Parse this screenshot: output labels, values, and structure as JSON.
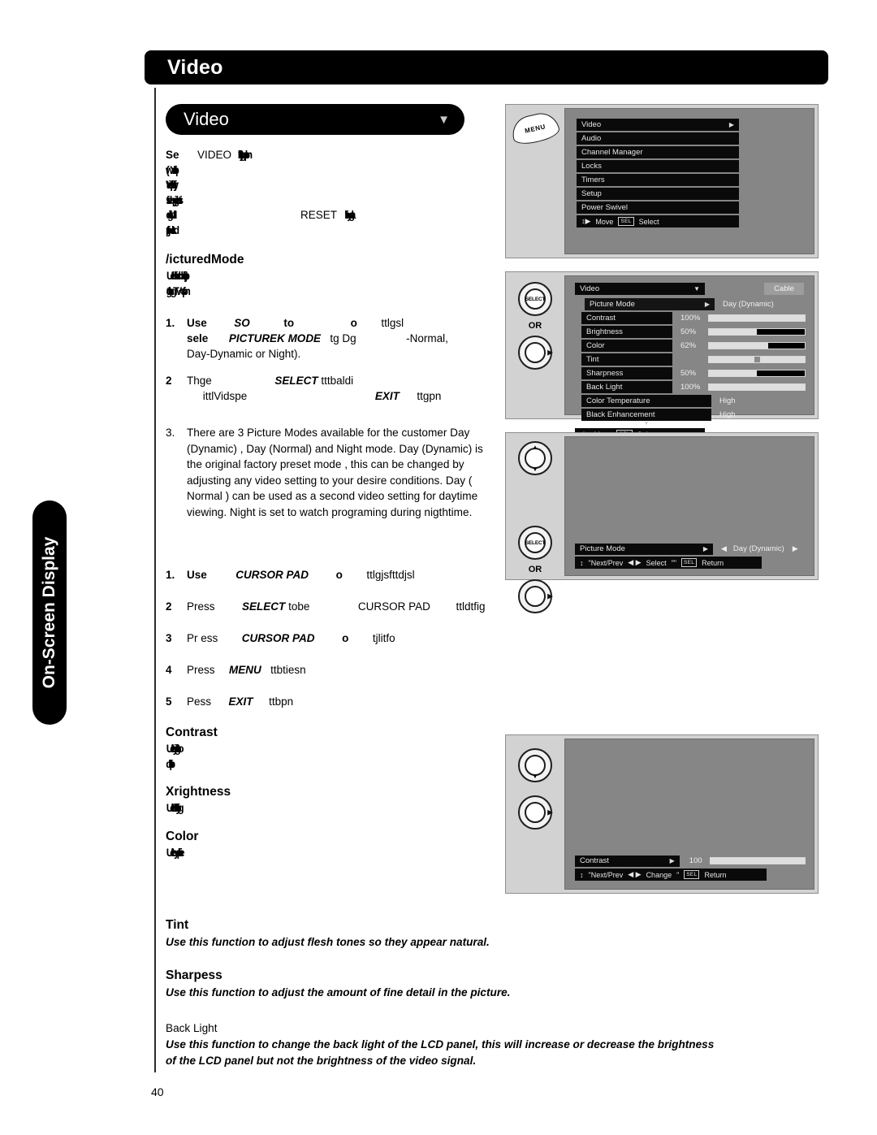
{
  "page": {
    "banner_title": "Video",
    "side_tab": "On-Screen Display",
    "page_number": "40"
  },
  "dropdown_pill": {
    "label": "Video",
    "caret": "▼"
  },
  "intro": {
    "line1_a": "Se",
    "line1_b": "VIDEO",
    "line1_c": "t)jltbgnlpn",
    "line2": "(wYqlfb",
    "line3": "tVidpsjfttiay",
    "line4": "fsebpjgbtsi",
    "line5_a": "digiMlf",
    "line5_b": "RESET",
    "line5_c": "ittbygla",
    "line6": "tpjlwcttkd"
  },
  "picture_mode": {
    "heading": "/icturedMode",
    "desc1": "Uebfbcbbfbtjp",
    "desc2": "tgtbgTV<sfpn",
    "steps": [
      {
        "idx": "1.",
        "a": "Use",
        "b": "SO",
        "c": "to",
        "d": "o",
        "e": "ttlgsl",
        "f": "sele",
        "g": "PICTUREK MODE",
        "h": "tg Dg",
        "i": "-Normal,",
        "j": "Day-Dynamic or Night)."
      },
      {
        "idx": "2",
        "a": "Thge",
        "b": "SELECT",
        "c": "tttbaldi",
        "d": "ittlVidspe",
        "e": "EXIT",
        "f": "ttgpn"
      }
    ],
    "para3_idx": "3.",
    "para3": "There are 3 Picture Modes  available for the customer Day (Dynamic) , Day (Normal) and Night mode. Day (Dynamic) is the original factory preset mode , this can be changed by adjusting any video setting  to your desire conditions. Day ( Normal ) can be used as a second video setting for daytime viewing. Night is set to watch programing during nigthtime."
  },
  "adjust_steps": [
    {
      "idx": "1.",
      "a": "Use",
      "b": "CURSOR PAD",
      "c": "o",
      "d": "ttlgjsfttdjsl",
      "e": "",
      "f": ""
    },
    {
      "idx": "2",
      "a": "Press",
      "b": "SELECT",
      "c": "tobe",
      "d": "CURSOR PAD",
      "e": "ttldtfig",
      "f": ""
    },
    {
      "idx": "3",
      "a": "Pr ess",
      "b": "CURSOR PAD",
      "c": "o",
      "d": "tjlitfo",
      "e": "",
      "f": ""
    },
    {
      "idx": "4",
      "a": "Press",
      "b": "MENU",
      "c": "ttbtiesn",
      "d": "",
      "e": "",
      "f": ""
    },
    {
      "idx": "5",
      "a": "Pess",
      "b": "EXIT",
      "c": "ttbpn",
      "d": "",
      "e": "",
      "f": ""
    }
  ],
  "settings_sections": [
    {
      "heading": "Contrast",
      "desc1": "Uetbiygttlbo",
      "desc2": "dbirttp"
    },
    {
      "heading": "Xrightness",
      "desc1": "Uetbfbyitlbg"
    },
    {
      "heading": "Color",
      "desc1": "Uetbysniitlpe"
    }
  ],
  "descriptions": [
    {
      "heading": "Tint",
      "style": "bold",
      "text": "Use this function to adjust flesh tones so they appear natural."
    },
    {
      "heading": "Sharpess",
      "style": "bold",
      "text": "Use this function to adjust the amount of fine detail in the picture."
    },
    {
      "heading": "Back Light",
      "style": "plain",
      "text": "Use this function to change the back light of the LCD panel, this will increase or decrease the brightness of the LCD panel but not the brightness of the video signal."
    }
  ],
  "osd_panel_main_menu": {
    "key_label": "MENU",
    "items": [
      {
        "label": "Video",
        "arrow": "▶"
      },
      {
        "label": "Audio",
        "arrow": ""
      },
      {
        "label": "Channel Manager",
        "arrow": ""
      },
      {
        "label": "Locks",
        "arrow": ""
      },
      {
        "label": "Timers",
        "arrow": ""
      },
      {
        "label": "Setup",
        "arrow": ""
      },
      {
        "label": "Power Swivel",
        "arrow": ""
      }
    ],
    "footer": {
      "move_icon": "↕▶",
      "move": "Move",
      "sel_key": "SEL",
      "select": "Select"
    }
  },
  "osd_panel_video": {
    "keys": {
      "select_label": "SELECT",
      "or_label": "OR"
    },
    "header": {
      "title": "Video",
      "caret": "▼",
      "source_badge": "Cable"
    },
    "rows": [
      {
        "label": "Picture Mode",
        "arrow": "▶",
        "value": "Day (Dynamic)",
        "pct": "",
        "fill": 0,
        "type": "text",
        "selected": true
      },
      {
        "label": "Contrast",
        "arrow": "",
        "value": "",
        "pct": "100%",
        "fill": 100,
        "type": "bar"
      },
      {
        "label": "Brightness",
        "arrow": "",
        "value": "",
        "pct": "50%",
        "fill": 50,
        "type": "bar"
      },
      {
        "label": "Color",
        "arrow": "",
        "value": "",
        "pct": "62%",
        "fill": 62,
        "type": "bar"
      },
      {
        "label": "Tint",
        "arrow": "",
        "value": "",
        "pct": "",
        "fill": 50,
        "type": "tint"
      },
      {
        "label": "Sharpness",
        "arrow": "",
        "value": "",
        "pct": "50%",
        "fill": 50,
        "type": "bar"
      },
      {
        "label": "Back Light",
        "arrow": "",
        "value": "",
        "pct": "100%",
        "fill": 100,
        "type": "bar"
      },
      {
        "label": "Color Temperature",
        "arrow": "",
        "value": "High",
        "pct": "",
        "fill": 0,
        "type": "text"
      },
      {
        "label": "Black Enhancement",
        "arrow": "",
        "value": "High",
        "pct": "",
        "fill": 0,
        "type": "text"
      }
    ],
    "scroll_down_icon": "▼",
    "footer": {
      "move_icon": "↕▶",
      "move": "Move",
      "sel_key": "SEL",
      "select": "Select"
    }
  },
  "osd_panel_picture_mode": {
    "keys": {
      "select_label": "SELECT",
      "or_label": "OR"
    },
    "row": {
      "label": "Picture Mode",
      "arrow": "▶",
      "left_arrow": "◀",
      "value": "Day (Dynamic)",
      "right_arrow": "▶"
    },
    "footer": {
      "nav_icon": "↕",
      "nav": "\"Next/Prev",
      "lr": "◀ ▶",
      "select": "Select",
      "quote": "\"\"",
      "sel_key": "SEL",
      "return": "Return"
    }
  },
  "osd_panel_contrast": {
    "row": {
      "label": "Contrast",
      "arrow": "▶",
      "value": "100",
      "fill": 100
    },
    "footer": {
      "nav_icon": "↕",
      "nav": "\"Next/Prev",
      "lr": "◀ ▶",
      "change": "Change",
      "quote": "\"",
      "sel_key": "SEL",
      "return": "Return"
    }
  }
}
